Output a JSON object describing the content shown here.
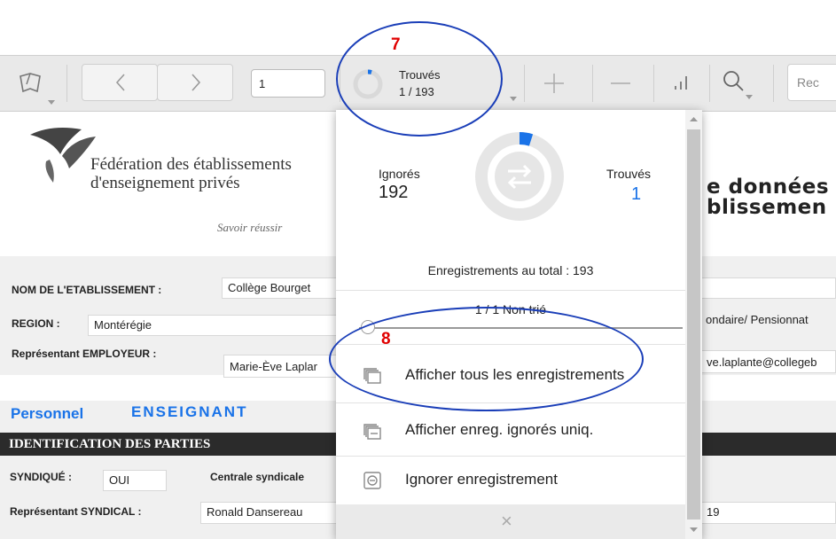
{
  "toolbar": {
    "page_value": "1",
    "found_label": "Trouvés",
    "found_count": "1 / 193",
    "search_placeholder": "Rec",
    "progress_fraction": 0.005
  },
  "annotations": {
    "seven": "7",
    "eight": "8"
  },
  "header": {
    "org_line1": "Fédération des établissements",
    "org_line2": "d'enseignement privés",
    "tagline": "Savoir réussir",
    "title_line1": "e données",
    "title_line2": "blissemen"
  },
  "form": {
    "nom_label": "NOM DE L'ETABLISSEMENT :",
    "nom_value": "Collège Bourget",
    "region_label": "REGION :",
    "region_value": "Montérégie",
    "type_value": "ondaire/ Pensionnat",
    "rep_employeur_label": "Représentant EMPLOYEUR :",
    "rep_employeur_value": "Marie-Ève Laplar",
    "email_value": "ve.laplante@collegeb"
  },
  "personnel": {
    "label": "Personnel",
    "category": "ENSEIGNANT",
    "section_title": "IDENTIFICATION DES PARTIES",
    "syndique_label": "SYNDIQUÉ :",
    "syndique_value": "OUI",
    "centrale_label": "Centrale syndicale",
    "rep_syndical_label": "Représentant SYNDICAL :",
    "rep_syndical_value": "Ronald Dansereau",
    "right_value": "19"
  },
  "popup": {
    "ignored_label": "Ignorés",
    "ignored_count": "192",
    "found_label": "Trouvés",
    "found_count": "1",
    "total_text": "Enregistrements au total : 193",
    "sort_text": "1 / 1 Non trié",
    "menu": [
      {
        "label": "Afficher tous les enregistrements",
        "icon": "stack-icon"
      },
      {
        "label": "Afficher enreg. ignorés uniq.",
        "icon": "stack-icon"
      },
      {
        "label": "Ignorer enregistrement",
        "icon": "omit-icon"
      }
    ],
    "close_glyph": "×"
  },
  "colors": {
    "accent_blue": "#1a73e8",
    "annotation_red": "#e00000",
    "ellipse_blue": "#1a3eb8"
  }
}
